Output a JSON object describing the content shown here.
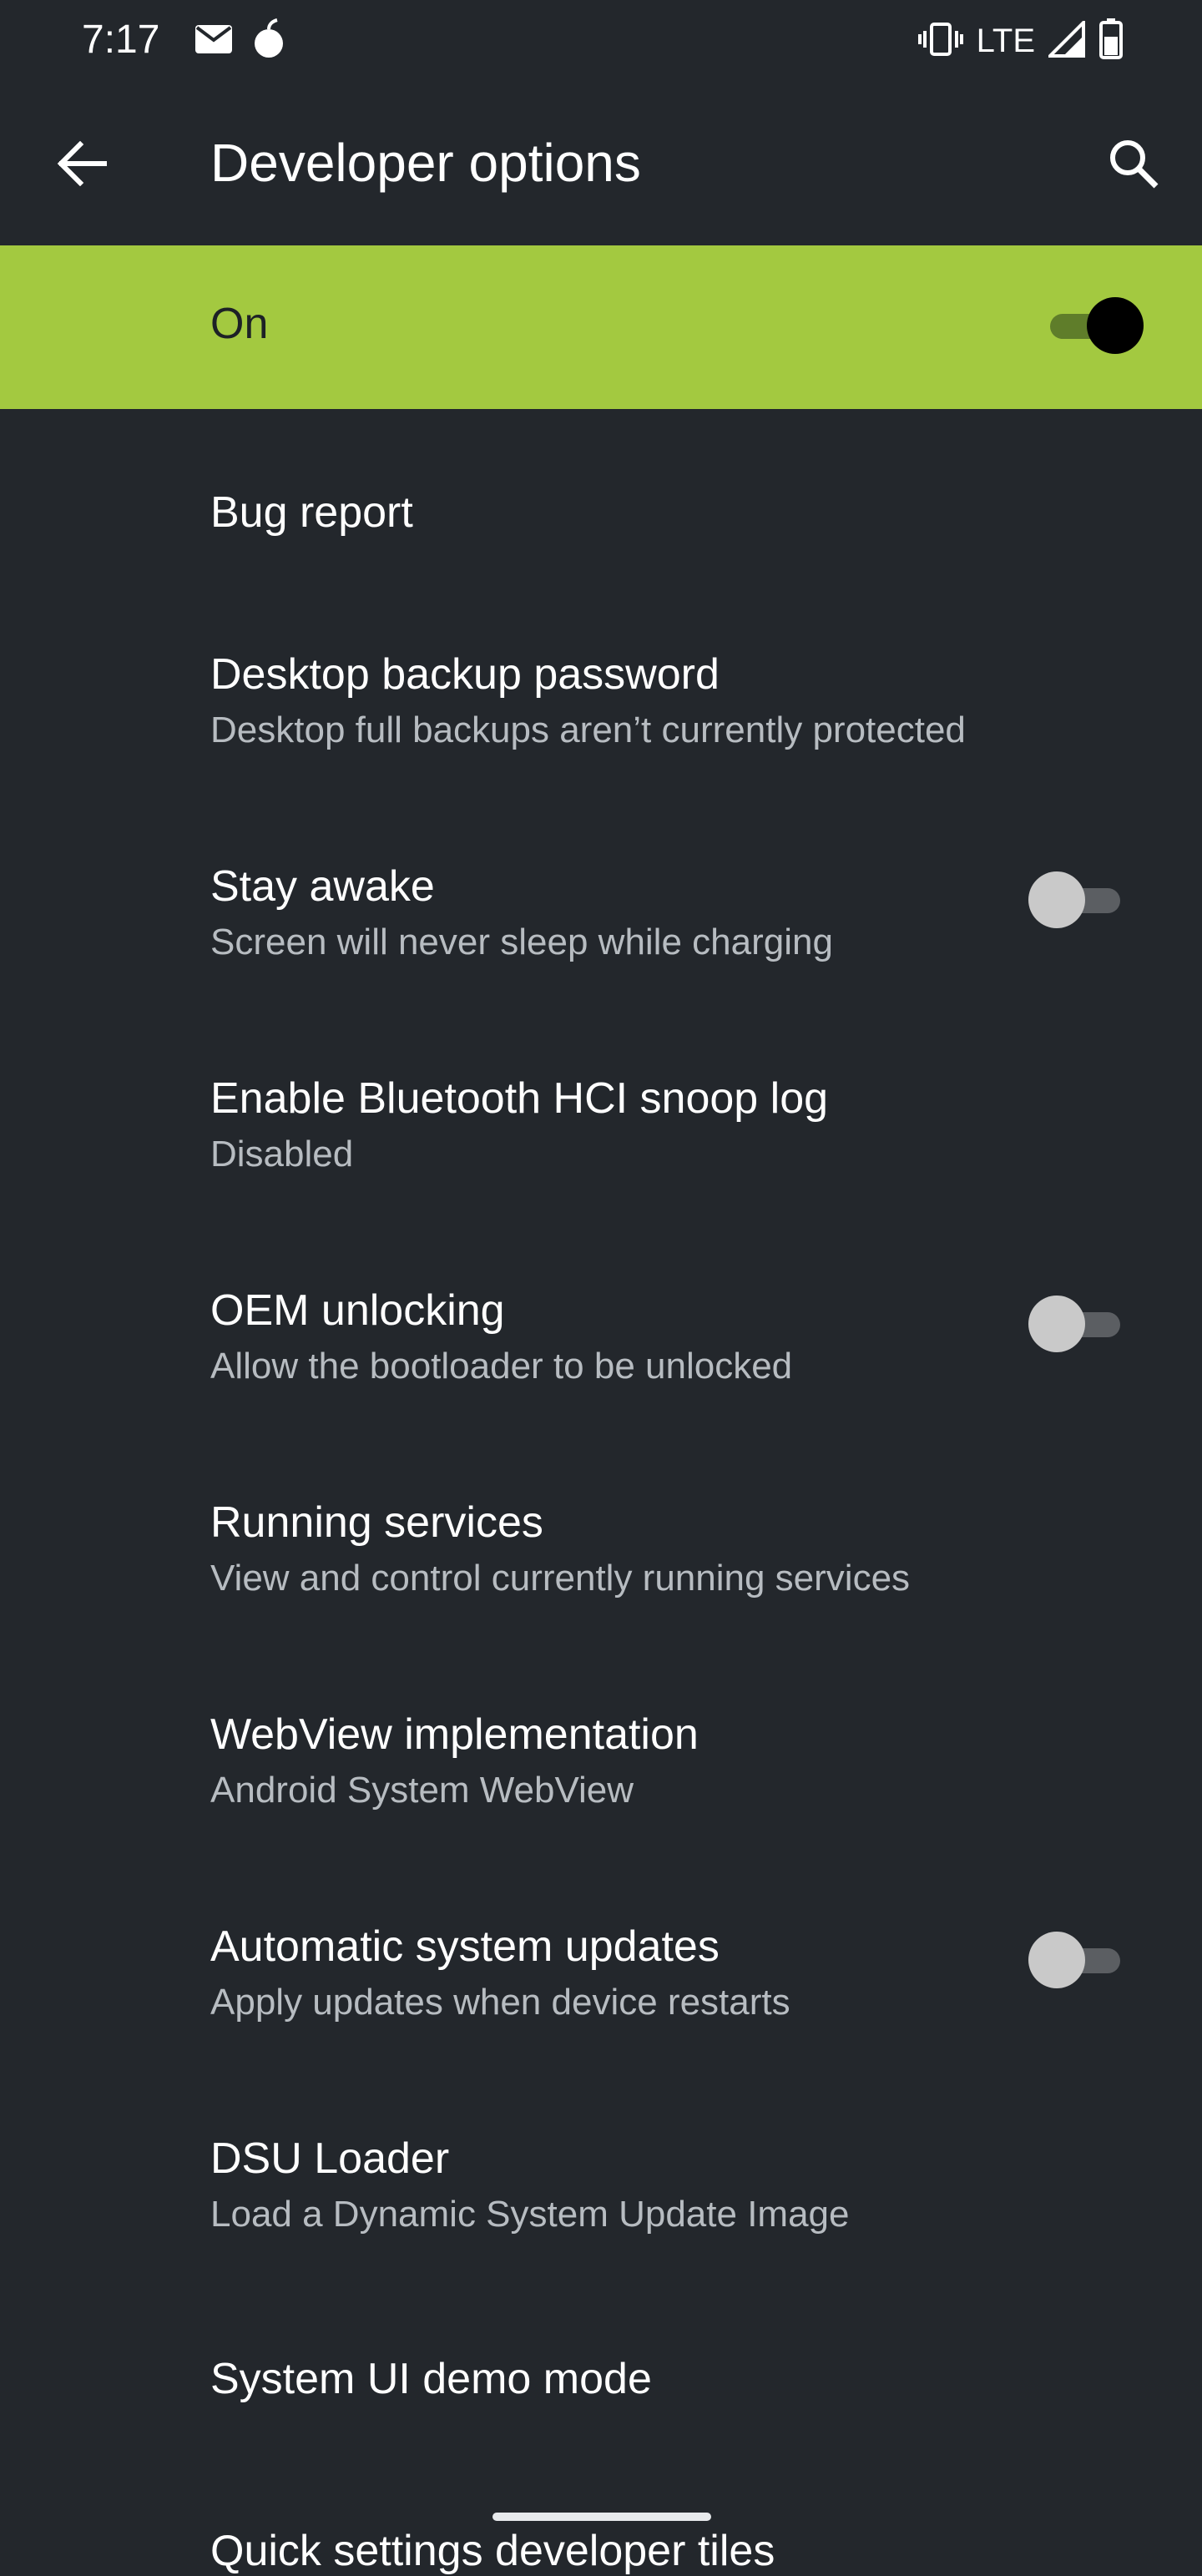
{
  "status_bar": {
    "time": "7:17",
    "network": "LTE",
    "left_icons": [
      "mail-icon",
      "notification-icon"
    ],
    "right_icons": [
      "vibrate-icon",
      "signal-icon",
      "battery-icon"
    ]
  },
  "app_bar": {
    "title": "Developer options",
    "back_icon": "back-arrow-icon",
    "search_icon": "search-icon"
  },
  "master_switch": {
    "label": "On",
    "checked": true
  },
  "items": [
    {
      "title": "Bug report",
      "subtitle": "",
      "toggle": null
    },
    {
      "title": "Desktop backup password",
      "subtitle": "Desktop full backups aren’t currently protected",
      "toggle": null
    },
    {
      "title": "Stay awake",
      "subtitle": "Screen will never sleep while charging",
      "toggle": false
    },
    {
      "title": "Enable Bluetooth HCI snoop log",
      "subtitle": "Disabled",
      "toggle": null
    },
    {
      "title": "OEM unlocking",
      "subtitle": "Allow the bootloader to be unlocked",
      "toggle": false
    },
    {
      "title": "Running services",
      "subtitle": "View and control currently running services",
      "toggle": null
    },
    {
      "title": "WebView implementation",
      "subtitle": "Android System WebView",
      "toggle": null
    },
    {
      "title": "Automatic system updates",
      "subtitle": "Apply updates when device restarts",
      "toggle": false
    },
    {
      "title": "DSU Loader",
      "subtitle": "Load a Dynamic System Update Image",
      "toggle": null
    },
    {
      "title": "System UI demo mode",
      "subtitle": "",
      "toggle": null
    },
    {
      "title": "Quick settings developer tiles",
      "subtitle": "",
      "toggle": null
    }
  ],
  "colors": {
    "background": "#23272c",
    "accent": "#a3c940"
  }
}
